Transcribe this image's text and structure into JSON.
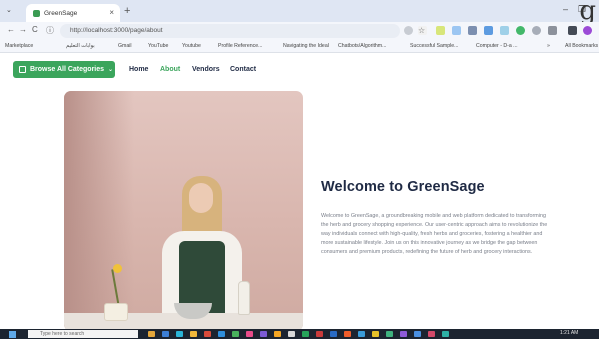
{
  "browser": {
    "tab_title": "GreenSage",
    "tab_close": "×",
    "new_tab": "+",
    "tab_menu": "⌄",
    "window_min": "–",
    "window_restore": "❐",
    "signature": "g",
    "url": "http://localhost:3000/page/about",
    "nav_back": "←",
    "nav_forward": "→",
    "nav_reload": "C",
    "site_info": "ⓘ"
  },
  "bookmarks": [
    "Marketplace",
    "بوابات التعليم",
    "Gmail",
    "YouTube",
    "Youtube",
    "Profile Reference...",
    "Navigating the Ideal",
    "Chatbots/Algorithm...",
    "Successful Sample...",
    "Computer - D-a ...",
    "»",
    "All Bookmarks"
  ],
  "site": {
    "browse_label": "Browse All Categories",
    "browse_chevron": "⌄",
    "nav": [
      {
        "label": "Home",
        "active": false
      },
      {
        "label": "About",
        "active": true
      },
      {
        "label": "Vendors",
        "active": false
      },
      {
        "label": "Contact",
        "active": false
      }
    ],
    "accent_color": "#3ba55c"
  },
  "about": {
    "title": "Welcome to GreenSage",
    "body": "Welcome to GreenSage, a groundbreaking mobile and web platform dedicated to transforming the herb and grocery shopping experience. Our user-centric approach aims to revolutionize the way individuals connect with high-quality, fresh herbs and groceries, fostering a healthier and more sustainable lifestyle. Join us on this innovative journey as we bridge the gap between consumers and premium products, redefining the future of herb and grocery interactions."
  },
  "taskbar": {
    "search_placeholder": "Type here to search",
    "clock": "1:21 AM"
  }
}
